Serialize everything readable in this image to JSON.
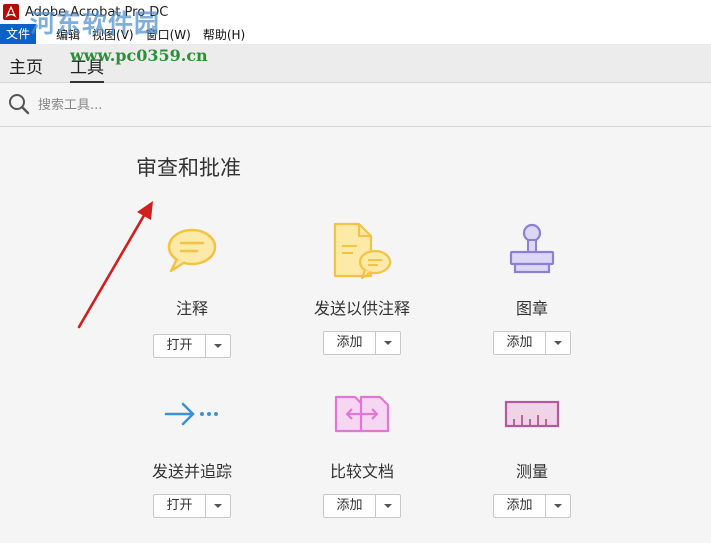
{
  "window": {
    "title": "Adobe Acrobat Pro DC",
    "app_icon": "acrobat-icon"
  },
  "menu": [
    {
      "label": "文件",
      "active": true
    },
    {
      "label": "编辑",
      "active": false
    },
    {
      "label": "视图(V)",
      "active": false
    },
    {
      "label": "窗口(W)",
      "active": false
    },
    {
      "label": "帮助(H)",
      "active": false
    }
  ],
  "watermark": {
    "text": "河东软件园",
    "url": "www.pc0359.cn"
  },
  "tabs": {
    "home": "主页",
    "tools": "工具",
    "active": "tools"
  },
  "search": {
    "placeholder": "搜索工具...",
    "value": "",
    "icon": "search-icon"
  },
  "section": {
    "title": "审查和批准"
  },
  "tools": [
    {
      "name": "comment",
      "label": "注释",
      "button": "打开",
      "icon": "speech-bubble-icon",
      "color": "#f5c243"
    },
    {
      "name": "send-for-comments",
      "label": "发送以供注释",
      "button": "添加",
      "icon": "document-comment-icon",
      "color": "#f5c243"
    },
    {
      "name": "stamp",
      "label": "图章",
      "button": "添加",
      "icon": "stamp-icon",
      "color": "#8c7fd4"
    },
    {
      "name": "send-and-track",
      "label": "发送并追踪",
      "button": "打开",
      "icon": "send-track-arrow-icon",
      "color": "#3d93d1"
    },
    {
      "name": "compare-files",
      "label": "比较文档",
      "button": "添加",
      "icon": "compare-files-icon",
      "color": "#e077d4"
    },
    {
      "name": "measure",
      "label": "测量",
      "button": "添加",
      "icon": "ruler-icon",
      "color": "#b8579b"
    }
  ],
  "annotation": {
    "arrow_color": "#d41e1e",
    "icon": "red-arrow-annotation"
  }
}
